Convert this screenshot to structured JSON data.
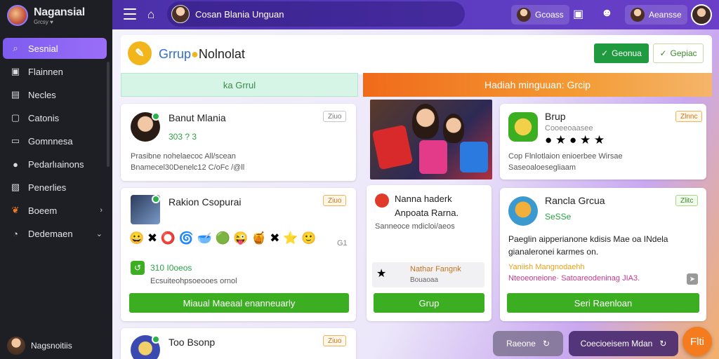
{
  "sidebar": {
    "brand_name": "Nagansial",
    "brand_sub": "Grcsy ♥",
    "items": [
      {
        "label": "Sesnial",
        "icon": "search-icon",
        "glyph": "⌕"
      },
      {
        "label": "Flainnen",
        "icon": "image-icon",
        "glyph": "▣"
      },
      {
        "label": "Necles",
        "icon": "photo-icon",
        "glyph": "▤"
      },
      {
        "label": "Catonis",
        "icon": "square-icon",
        "glyph": "▢"
      },
      {
        "label": "Gomnnesa",
        "icon": "card-icon",
        "glyph": "▭"
      },
      {
        "label": "Pedarlıainons",
        "icon": "circle-icon",
        "glyph": "●"
      },
      {
        "label": "Penerlies",
        "icon": "chart-icon",
        "glyph": "▧"
      },
      {
        "label": "Boeem",
        "icon": "gift-icon",
        "glyph": "❦"
      },
      {
        "label": "Dedemaen",
        "icon": "gauge-icon",
        "glyph": "◔"
      }
    ],
    "footer_user": "Nagsnoitiis"
  },
  "topbar": {
    "search_text": "Cosan Blania Unguan",
    "chip1_label": "Gcoass",
    "chip2_label": "Aeansse"
  },
  "panel": {
    "title_a": "Grrup",
    "title_b": "Nolnolat",
    "btn_primary": "Geonua",
    "btn_secondary": "Gepiac"
  },
  "tabs": {
    "left": "ka Grrul",
    "right": "Hadiah minguuan: Grcip"
  },
  "cards": {
    "c1": {
      "title": "Banut Mlania",
      "tag": "Ziuo",
      "sub": "303 ? 3",
      "desc1": "Prasibne nohelaecoc All/scean",
      "desc2": "Bnamecel30Denelc12 C/oFc /@ll"
    },
    "c2": {
      "title": "Rakion Csopurai",
      "tag": "Ziuo",
      "emojis": "😀 ✖ ⭕ 🌀 🥣 🟢 😜 🍯 ✖ ⭐ 🙂",
      "count": "G1",
      "sub": "310 I0oeos",
      "desc": "Ecsuiteohpsoeooes ornol",
      "btn": "Miaual Maeaal enanneuarly"
    },
    "c3": {
      "title": "Too Bsonp",
      "tag": "Ziuo"
    },
    "c4": {
      "title": "Nanna haderk",
      "title2": "Anpoata Rarna.",
      "desc": "Sanneoce mdicloi/aeos",
      "mini_title": "Nathar Fangnk",
      "mini_sub": "Bouaoaa",
      "btn": "Grup"
    },
    "c5": {
      "title": "Brup",
      "tag": "Zlnnc",
      "sub": "Cooeeoaasee",
      "desc1": "Cop Flnlotlaion enioerbee Wirsae",
      "desc2": "Saseoaloesegliaam"
    },
    "c6": {
      "title": "Rancla Grcua",
      "tag": "Zlitc",
      "sub": "SeSSe",
      "desc1": "Paeglin aipperianone kdisis Mae oa INdela",
      "desc2": "gianaleronei karmes on.",
      "highlight": "Yaniish Mangnodaehh",
      "desc3": "Nteoeoneione· Satoareodeninag JIA3.",
      "btn": "Seri Raenloan"
    }
  },
  "bottom": {
    "pill1": "Raeone",
    "pill2": "Coecioeisem Mdan",
    "fab": "Flti"
  },
  "colors": {
    "accent": "#7d5cf0",
    "green": "#3cae22",
    "orange": "#f47c1e"
  }
}
